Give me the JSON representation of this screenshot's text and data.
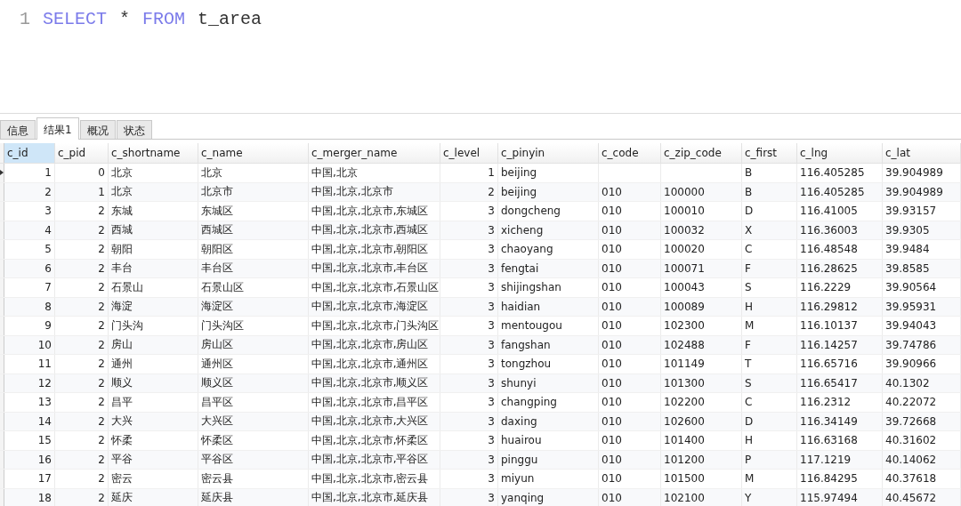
{
  "editor": {
    "lines": [
      {
        "number": "1",
        "tokens": [
          {
            "text": "SELECT",
            "kind": "keyword"
          },
          {
            "text": "*",
            "kind": "plain"
          },
          {
            "text": "FROM",
            "kind": "keyword"
          },
          {
            "text": "t_area",
            "kind": "plain"
          }
        ]
      }
    ]
  },
  "tabs": [
    {
      "label": "信息",
      "selected": false
    },
    {
      "label": "结果1",
      "selected": true
    },
    {
      "label": "概况",
      "selected": false
    },
    {
      "label": "状态",
      "selected": false
    }
  ],
  "table": {
    "columns": [
      {
        "name": "c_id",
        "selected": true
      },
      {
        "name": "c_pid",
        "selected": false
      },
      {
        "name": "c_shortname",
        "selected": false
      },
      {
        "name": "c_name",
        "selected": false
      },
      {
        "name": "c_merger_name",
        "selected": false
      },
      {
        "name": "c_level",
        "selected": false
      },
      {
        "name": "c_pinyin",
        "selected": false
      },
      {
        "name": "c_code",
        "selected": false
      },
      {
        "name": "c_zip_code",
        "selected": false
      },
      {
        "name": "c_first",
        "selected": false
      },
      {
        "name": "c_lng",
        "selected": false
      },
      {
        "name": "c_lat",
        "selected": false
      }
    ],
    "rows": [
      {
        "current": true,
        "cells": [
          "1",
          "0",
          "北京",
          "北京",
          "中国,北京",
          "1",
          "beijing",
          null,
          null,
          "B",
          "116.405285",
          "39.904989"
        ]
      },
      {
        "current": false,
        "cells": [
          "2",
          "1",
          "北京",
          "北京市",
          "中国,北京,北京市",
          "2",
          "beijing",
          "010",
          "100000",
          "B",
          "116.405285",
          "39.904989"
        ]
      },
      {
        "current": false,
        "cells": [
          "3",
          "2",
          "东城",
          "东城区",
          "中国,北京,北京市,东城区",
          "3",
          "dongcheng",
          "010",
          "100010",
          "D",
          "116.41005",
          "39.93157"
        ]
      },
      {
        "current": false,
        "cells": [
          "4",
          "2",
          "西城",
          "西城区",
          "中国,北京,北京市,西城区",
          "3",
          "xicheng",
          "010",
          "100032",
          "X",
          "116.36003",
          "39.9305"
        ]
      },
      {
        "current": false,
        "cells": [
          "5",
          "2",
          "朝阳",
          "朝阳区",
          "中国,北京,北京市,朝阳区",
          "3",
          "chaoyang",
          "010",
          "100020",
          "C",
          "116.48548",
          "39.9484"
        ]
      },
      {
        "current": false,
        "cells": [
          "6",
          "2",
          "丰台",
          "丰台区",
          "中国,北京,北京市,丰台区",
          "3",
          "fengtai",
          "010",
          "100071",
          "F",
          "116.28625",
          "39.8585"
        ]
      },
      {
        "current": false,
        "cells": [
          "7",
          "2",
          "石景山",
          "石景山区",
          "中国,北京,北京市,石景山区",
          "3",
          "shijingshan",
          "010",
          "100043",
          "S",
          "116.2229",
          "39.90564"
        ]
      },
      {
        "current": false,
        "cells": [
          "8",
          "2",
          "海淀",
          "海淀区",
          "中国,北京,北京市,海淀区",
          "3",
          "haidian",
          "010",
          "100089",
          "H",
          "116.29812",
          "39.95931"
        ]
      },
      {
        "current": false,
        "cells": [
          "9",
          "2",
          "门头沟",
          "门头沟区",
          "中国,北京,北京市,门头沟区",
          "3",
          "mentougou",
          "010",
          "102300",
          "M",
          "116.10137",
          "39.94043"
        ]
      },
      {
        "current": false,
        "cells": [
          "10",
          "2",
          "房山",
          "房山区",
          "中国,北京,北京市,房山区",
          "3",
          "fangshan",
          "010",
          "102488",
          "F",
          "116.14257",
          "39.74786"
        ]
      },
      {
        "current": false,
        "cells": [
          "11",
          "2",
          "通州",
          "通州区",
          "中国,北京,北京市,通州区",
          "3",
          "tongzhou",
          "010",
          "101149",
          "T",
          "116.65716",
          "39.90966"
        ]
      },
      {
        "current": false,
        "cells": [
          "12",
          "2",
          "顺义",
          "顺义区",
          "中国,北京,北京市,顺义区",
          "3",
          "shunyi",
          "010",
          "101300",
          "S",
          "116.65417",
          "40.1302"
        ]
      },
      {
        "current": false,
        "cells": [
          "13",
          "2",
          "昌平",
          "昌平区",
          "中国,北京,北京市,昌平区",
          "3",
          "changping",
          "010",
          "102200",
          "C",
          "116.2312",
          "40.22072"
        ]
      },
      {
        "current": false,
        "cells": [
          "14",
          "2",
          "大兴",
          "大兴区",
          "中国,北京,北京市,大兴区",
          "3",
          "daxing",
          "010",
          "102600",
          "D",
          "116.34149",
          "39.72668"
        ]
      },
      {
        "current": false,
        "cells": [
          "15",
          "2",
          "怀柔",
          "怀柔区",
          "中国,北京,北京市,怀柔区",
          "3",
          "huairou",
          "010",
          "101400",
          "H",
          "116.63168",
          "40.31602"
        ]
      },
      {
        "current": false,
        "cells": [
          "16",
          "2",
          "平谷",
          "平谷区",
          "中国,北京,北京市,平谷区",
          "3",
          "pinggu",
          "010",
          "101200",
          "P",
          "117.1219",
          "40.14062"
        ]
      },
      {
        "current": false,
        "cells": [
          "17",
          "2",
          "密云",
          "密云县",
          "中国,北京,北京市,密云县",
          "3",
          "miyun",
          "010",
          "101500",
          "M",
          "116.84295",
          "40.37618"
        ]
      },
      {
        "current": false,
        "cells": [
          "18",
          "2",
          "延庆",
          "延庆县",
          "中国,北京,北京市,延庆县",
          "3",
          "yanqing",
          "010",
          "102100",
          "Y",
          "115.97494",
          "40.45672"
        ]
      }
    ]
  }
}
